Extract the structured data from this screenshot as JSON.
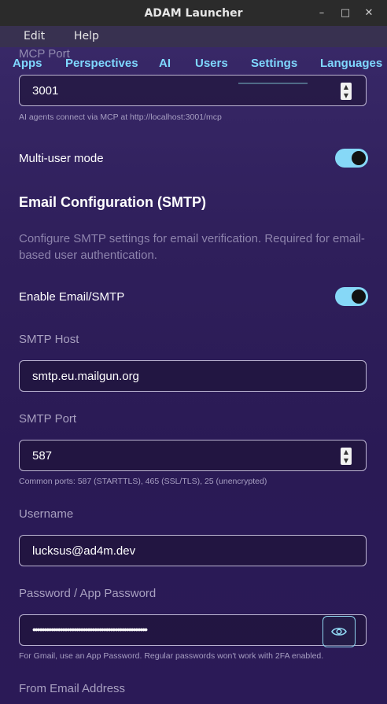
{
  "window": {
    "title": "ADAM Launcher",
    "controls": {
      "minimize": "–",
      "maximize": "□",
      "close": "✕"
    }
  },
  "menu": {
    "edit": "Edit",
    "help": "Help"
  },
  "tabs": [
    {
      "label": "Apps",
      "active": false
    },
    {
      "label": "Perspectives",
      "active": false
    },
    {
      "label": "AI",
      "active": false
    },
    {
      "label": "Users",
      "active": false
    },
    {
      "label": "Settings",
      "active": true
    },
    {
      "label": "Languages",
      "active": false
    }
  ],
  "mcp": {
    "label": "MCP Port",
    "value": "3001",
    "hint": "AI agents connect via MCP at http://localhost:3001/mcp"
  },
  "multi_user": {
    "label": "Multi-user mode",
    "enabled": true
  },
  "email": {
    "heading": "Email Configuration (SMTP)",
    "description": "Configure SMTP settings for email verification. Required for email-based user authentication.",
    "enable_label": "Enable Email/SMTP",
    "enabled": true,
    "host_label": "SMTP Host",
    "host_value": "smtp.eu.mailgun.org",
    "port_label": "SMTP Port",
    "port_value": "587",
    "port_hint": "Common ports: 587 (STARTTLS), 465 (SSL/TLS), 25 (unencrypted)",
    "username_label": "Username",
    "username_value": "lucksus@ad4m.dev",
    "password_label": "Password / App Password",
    "password_value": "••••••••••••••••••••••••••••••••••••••••••••••••••",
    "password_hint": "For Gmail, use an App Password. Regular passwords won't work with 2FA enabled.",
    "from_label": "From Email Address"
  },
  "colors": {
    "accent": "#86d8f7",
    "tab_text": "#7fd8ff",
    "background": "#2f1f5b"
  }
}
